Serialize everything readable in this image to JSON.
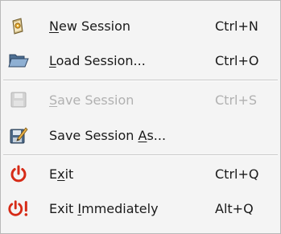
{
  "menu": {
    "items": [
      {
        "before": "",
        "mnemonic": "N",
        "after": "ew Session",
        "shortcut": "Ctrl+N",
        "icon": "new-session-icon",
        "enabled": true
      },
      {
        "before": "",
        "mnemonic": "L",
        "after": "oad Session...",
        "shortcut": "Ctrl+O",
        "icon": "folder-open-icon",
        "enabled": true
      },
      {
        "before": "",
        "mnemonic": "S",
        "after": "ave Session",
        "shortcut": "Ctrl+S",
        "icon": "floppy-disk-icon",
        "enabled": false
      },
      {
        "before": "Save Session ",
        "mnemonic": "A",
        "after": "s...",
        "shortcut": "",
        "icon": "save-as-icon",
        "enabled": true
      },
      {
        "before": "E",
        "mnemonic": "x",
        "after": "it",
        "shortcut": "Ctrl+Q",
        "icon": "power-icon",
        "enabled": true
      },
      {
        "before": "Exit ",
        "mnemonic": "I",
        "after": "mmediately",
        "shortcut": "Alt+Q",
        "icon": "power-urgent-icon",
        "enabled": true
      }
    ]
  },
  "colors": {
    "background": "#f4f4f4",
    "text": "#1a1a1a",
    "disabled_text": "#b1b1b1",
    "exit_red": "#d62b17"
  }
}
